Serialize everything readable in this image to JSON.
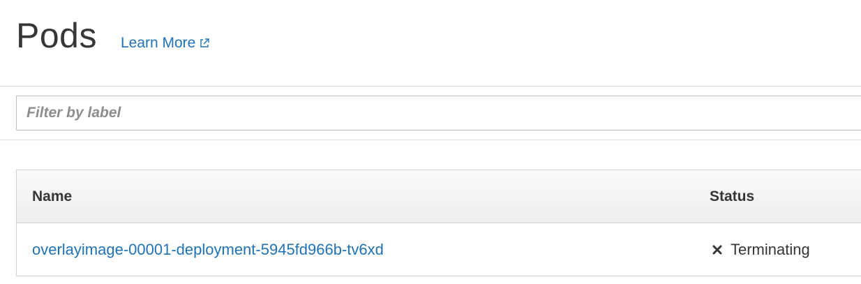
{
  "header": {
    "title": "Pods",
    "learn_more_label": "Learn More"
  },
  "filter": {
    "placeholder": "Filter by label",
    "value": ""
  },
  "table": {
    "columns": [
      "Name",
      "Status"
    ],
    "rows": [
      {
        "name": "overlayimage-00001-deployment-5945fd966b-tv6xd",
        "status": "Terminating",
        "status_icon": "x-icon"
      }
    ]
  },
  "colors": {
    "link": "#1f72b8",
    "text": "#363636",
    "placeholder": "#8b8d8f"
  }
}
